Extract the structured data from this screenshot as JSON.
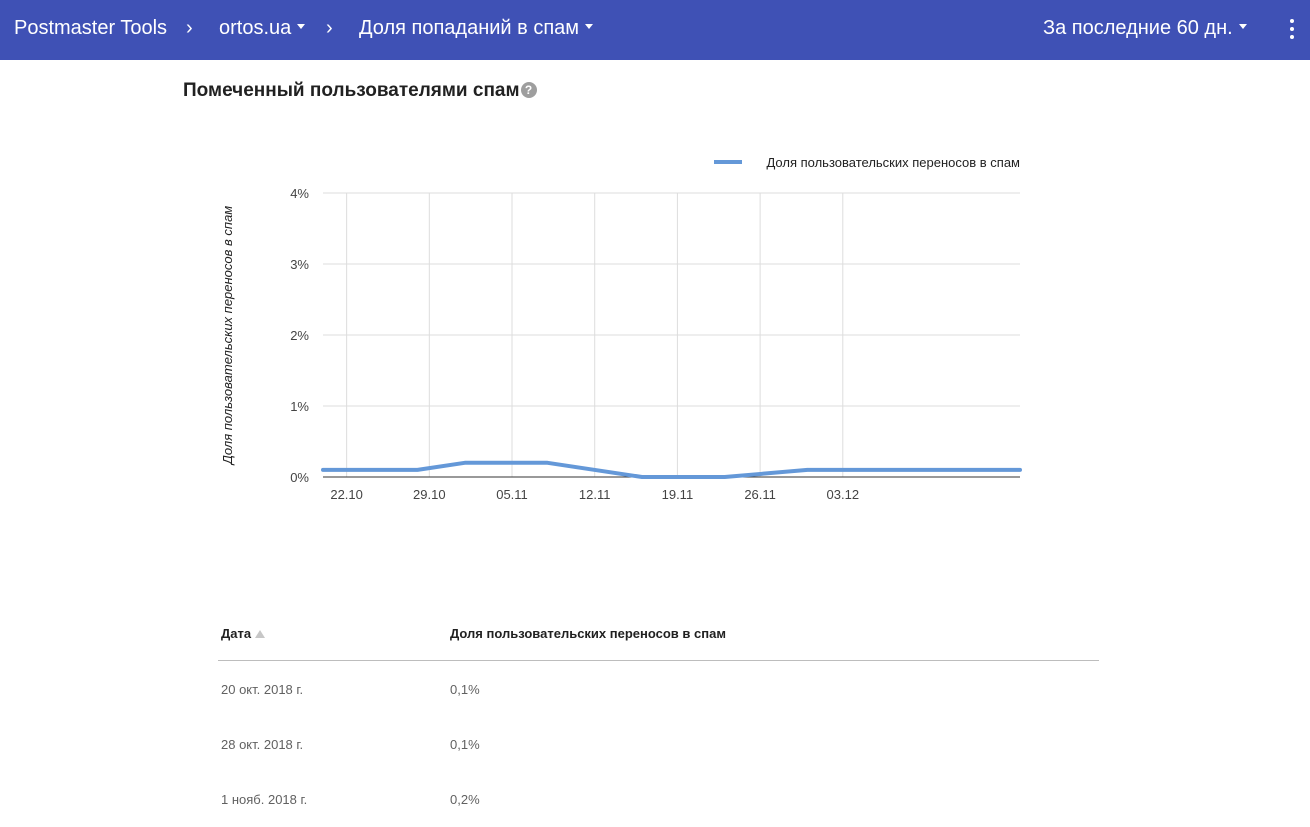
{
  "header": {
    "app_title": "Postmaster Tools",
    "separator": "›",
    "domain": "ortos.ua",
    "report": "Доля попаданий в спам",
    "period": "За последние 60 дн."
  },
  "section": {
    "title": "Помеченный пользователями спам",
    "help": "?"
  },
  "chart_data": {
    "type": "line",
    "ylabel": "Доля пользовательских переносов в спам",
    "xlabel": "",
    "legend": {
      "position": "top-right"
    },
    "grid": true,
    "y_ticks": [
      "0%",
      "1%",
      "2%",
      "3%",
      "4%"
    ],
    "ylim": [
      0,
      4
    ],
    "x_ticks": [
      "22.10",
      "29.10",
      "05.11",
      "12.11",
      "19.11",
      "26.11",
      "03.12"
    ],
    "x_tick_dates": [
      "2018-10-22",
      "2018-10-29",
      "2018-11-05",
      "2018-11-12",
      "2018-11-19",
      "2018-11-26",
      "2018-12-03"
    ],
    "xlim": [
      "2018-10-20",
      "2018-12-18"
    ],
    "color": "#6498d8",
    "series": [
      {
        "name": "Доля пользовательских переносов в спам",
        "points": [
          {
            "x": "2018-10-20",
            "y": 0.1
          },
          {
            "x": "2018-10-28",
            "y": 0.1
          },
          {
            "x": "2018-11-01",
            "y": 0.2
          },
          {
            "x": "2018-11-08",
            "y": 0.2
          },
          {
            "x": "2018-11-16",
            "y": 0.0
          },
          {
            "x": "2018-11-23",
            "y": 0.0
          },
          {
            "x": "2018-11-30",
            "y": 0.1
          },
          {
            "x": "2018-12-18",
            "y": 0.1
          }
        ]
      }
    ]
  },
  "table": {
    "columns": [
      "Дата",
      "Доля пользовательских переносов в спам"
    ],
    "rows": [
      [
        "20 окт. 2018 г.",
        "0,1%"
      ],
      [
        "28 окт. 2018 г.",
        "0,1%"
      ],
      [
        "1 нояб. 2018 г.",
        "0,2%"
      ]
    ]
  }
}
